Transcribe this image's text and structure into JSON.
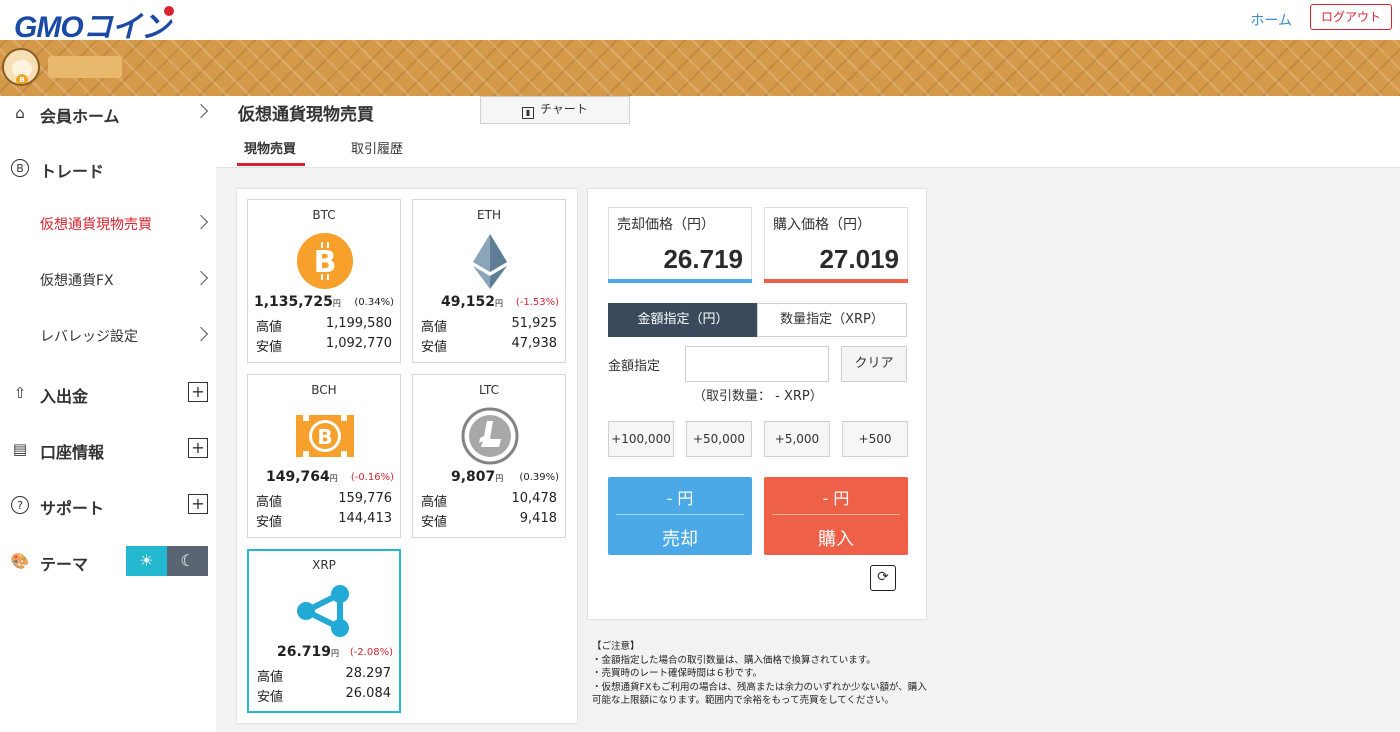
{
  "header": {
    "logo_text": "GMOコイン",
    "home_link": "ホーム",
    "logout_button": "ログアウト"
  },
  "sidebar": {
    "items": [
      {
        "label": "会員ホーム",
        "icon": "home-icon",
        "control": "chevron"
      },
      {
        "label": "トレード",
        "icon": "bitcoin-circle-icon",
        "control": "none"
      },
      {
        "label": "仮想通貨現物売買",
        "icon": "",
        "control": "chevron",
        "active": true
      },
      {
        "label": "仮想通貨FX",
        "icon": "",
        "control": "chevron"
      },
      {
        "label": "レバレッジ設定",
        "icon": "",
        "control": "chevron"
      },
      {
        "label": "入出金",
        "icon": "deposit-icon",
        "control": "plus"
      },
      {
        "label": "口座情報",
        "icon": "account-icon",
        "control": "plus"
      },
      {
        "label": "サポート",
        "icon": "question-icon",
        "control": "plus"
      },
      {
        "label": "テーマ",
        "icon": "palette-icon",
        "control": "theme-toggle"
      }
    ],
    "plus_symbol": "+",
    "theme_light_symbol": "☀",
    "theme_dark_symbol": "☾"
  },
  "page": {
    "title": "仮想通貨現物売買",
    "chart_button": "チャート",
    "tabs": [
      {
        "label": "現物売買",
        "active": true
      },
      {
        "label": "取引履歴",
        "active": false
      }
    ]
  },
  "coins": [
    {
      "name": "BTC",
      "price": "1,135,725",
      "unit": "円",
      "change": "(0.34%)",
      "negative": false,
      "high_label": "高値",
      "high": "1,199,580",
      "low_label": "安値",
      "low": "1,092,770",
      "color": "#f7a02c"
    },
    {
      "name": "ETH",
      "price": "49,152",
      "unit": "円",
      "change": "(-1.53%)",
      "negative": true,
      "high_label": "高値",
      "high": "51,925",
      "low_label": "安値",
      "low": "47,938",
      "color": "#6f8ea5"
    },
    {
      "name": "BCH",
      "price": "149,764",
      "unit": "円",
      "change": "(-0.16%)",
      "negative": true,
      "high_label": "高値",
      "high": "159,776",
      "low_label": "安値",
      "low": "144,413",
      "color": "#f7a02c"
    },
    {
      "name": "LTC",
      "price": "9,807",
      "unit": "円",
      "change": "(0.39%)",
      "negative": false,
      "high_label": "高値",
      "high": "10,478",
      "low_label": "安値",
      "low": "9,418",
      "color": "#838383"
    },
    {
      "name": "XRP",
      "price": "26.719",
      "unit": "円",
      "change": "(-2.08%)",
      "negative": true,
      "high_label": "高値",
      "high": "28.297",
      "low_label": "安値",
      "low": "26.084",
      "color": "#23a9d6",
      "selected": true
    }
  ],
  "order": {
    "sell_label": "売却価格（円）",
    "sell_price": "26.719",
    "buy_label": "購入価格（円）",
    "buy_price": "27.019",
    "mode_amount": "金額指定（円）",
    "mode_quantity": "数量指定（XRP）",
    "amount_label": "金額指定",
    "amount_value": "",
    "clear_button": "クリア",
    "quantity_note": "（取引数量： - XRP）",
    "steps": [
      "+100,000",
      "+50,000",
      "+5,000",
      "+500"
    ],
    "sell_yen": "- 円",
    "sell_action": "売却",
    "buy_yen": "- 円",
    "buy_action": "購入",
    "refresh_symbol": "⟳",
    "colors": {
      "sell": "#4aa9e6",
      "buy": "#ef6048",
      "mode_active": "#3a4a5c"
    }
  },
  "notice": {
    "lines": [
      "【ご注意】",
      "・金額指定した場合の取引数量は、購入価格で換算されています。",
      "・売買時のレート確保時間は６秒です。",
      "・仮想通貨FXもご利用の場合は、残高または余力のいずれか少ない額が、購入可能な上限額になります。範囲内で余裕をもって売買をしてください。"
    ]
  }
}
